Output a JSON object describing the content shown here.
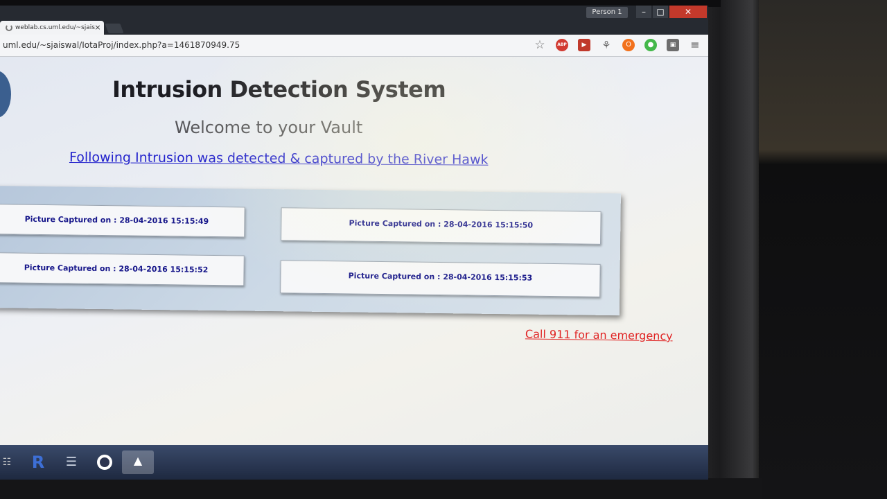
{
  "window": {
    "profile_label": "Person 1",
    "minimize_glyph": "–",
    "maximize_glyph": "□",
    "close_glyph": "✕"
  },
  "tabs": [
    {
      "title": "weblab.cs.uml.edu/~sjais",
      "close_glyph": "×"
    }
  ],
  "address_bar": {
    "url": "uml.edu/~sjaiswal/IotaProj/index.php?a=1461870949.75"
  },
  "extensions": {
    "star_glyph": "☆",
    "abp_label": "ABP",
    "play_glyph": "▶",
    "puzzle_glyph": "⚘",
    "orange_glyph": "O",
    "green_glyph": "●",
    "box_glyph": "▣",
    "menu_glyph": "≡"
  },
  "page": {
    "title": "Intrusion Detection System",
    "subtitle": "Welcome to your Vault",
    "intrusion_link": "Following Intrusion was detected & captured by the River Hawk",
    "captures": [
      {
        "label": "Picture Captured on : 28-04-2016 15:15:49"
      },
      {
        "label": "Picture Captured on : 28-04-2016 15:15:50"
      },
      {
        "label": "Picture Captured on : 28-04-2016 15:15:52"
      },
      {
        "label": "Picture Captured on : 28-04-2016 15:15:53"
      }
    ],
    "emergency_link": "Call 911 for an emergency"
  },
  "taskbar": {
    "start_glyph": "☷",
    "r_label": "R",
    "files_glyph": "☰",
    "active_glyph": "▲"
  },
  "colors": {
    "link_blue": "#2222cc",
    "emergency_red": "#e02424",
    "capture_text": "#16168a"
  }
}
